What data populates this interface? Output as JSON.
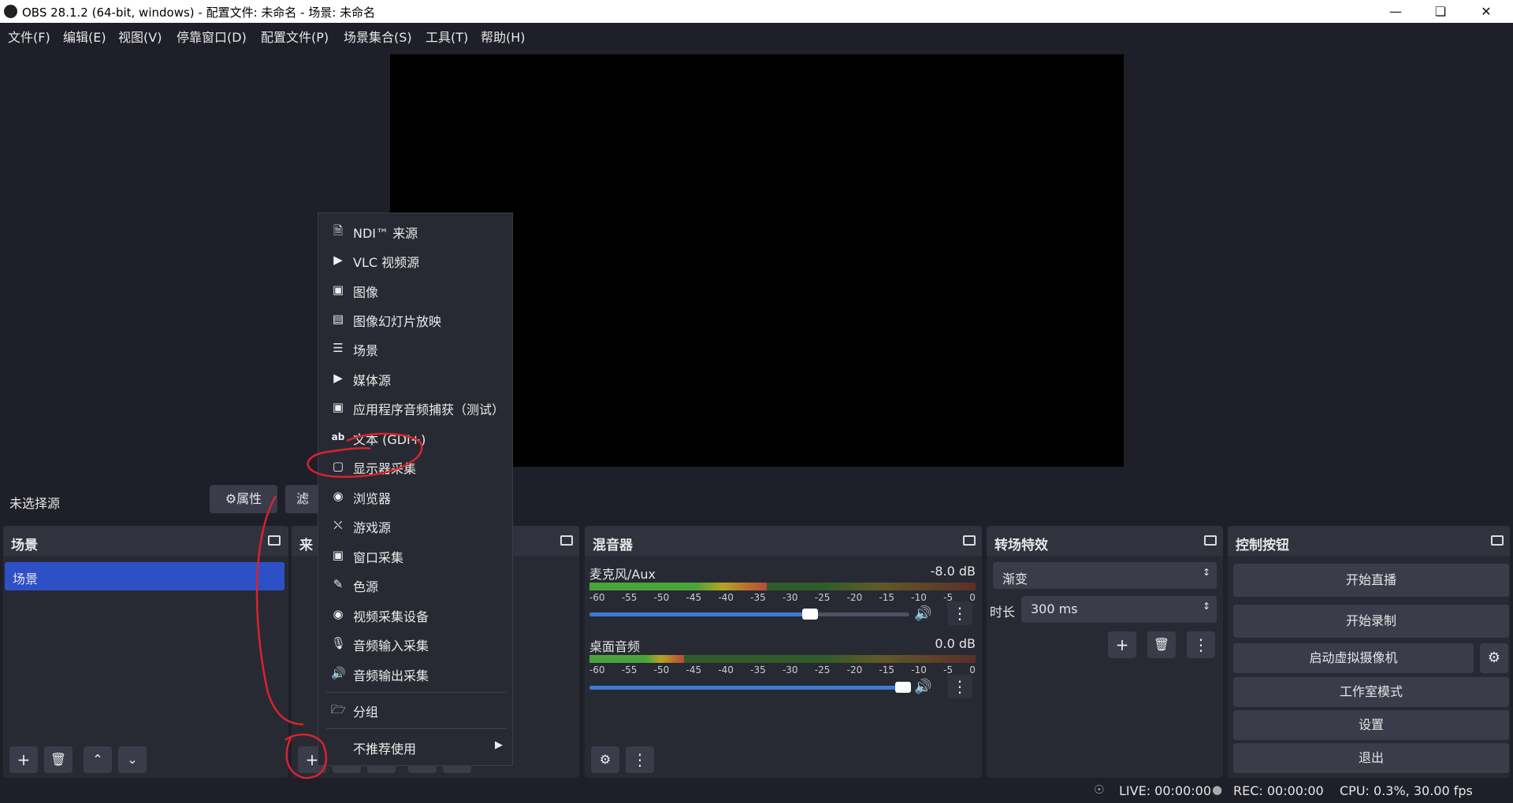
{
  "window": {
    "title": "OBS 28.1.2 (64-bit, windows) - 配置文件: 未命名 - 场景: 未命名",
    "minimize_icon": "minimize-icon",
    "maximize_icon": "restore-icon",
    "close_icon": "close-icon"
  },
  "menu": [
    "文件(F)",
    "编辑(E)",
    "视图(V)",
    "停靠窗口(D)",
    "配置文件(P)",
    "场景集合(S)",
    "工具(T)",
    "帮助(H)"
  ],
  "source_bar": {
    "no_source": "未选择源",
    "properties": "属性",
    "filters_partial": "滤"
  },
  "scenes": {
    "title": "场景",
    "items": [
      "场景"
    ],
    "selected_color": "#2e50c7"
  },
  "sources": {
    "title_partial": "来"
  },
  "mixer": {
    "title": "混音器",
    "channels": [
      {
        "name": "麦克风/Aux",
        "db": "-8.0 dB",
        "volume_fraction": 0.69
      },
      {
        "name": "桌面音频",
        "db": "0.0 dB",
        "volume_fraction": 0.98
      }
    ],
    "ticks": [
      "-60",
      "-55",
      "-50",
      "-45",
      "-40",
      "-35",
      "-30",
      "-25",
      "-20",
      "-15",
      "-10",
      "-5",
      "0"
    ]
  },
  "transitions": {
    "title": "转场特效",
    "selected": "渐变",
    "duration_label": "时长",
    "duration_value": "300 ms"
  },
  "controls": {
    "title": "控制按钮",
    "start_stream": "开始直播",
    "start_record": "开始录制",
    "virtual_cam": "启动虚拟摄像机",
    "studio_mode": "工作室模式",
    "settings": "设置",
    "exit": "退出"
  },
  "context_menu": {
    "items": [
      {
        "label": "NDI™ 来源",
        "icon": "file-icon"
      },
      {
        "label": "VLC 视频源",
        "icon": "play-icon"
      },
      {
        "label": "图像",
        "icon": "image-icon"
      },
      {
        "label": "图像幻灯片放映",
        "icon": "slideshow-icon"
      },
      {
        "label": "场景",
        "icon": "list-icon"
      },
      {
        "label": "媒体源",
        "icon": "play-icon"
      },
      {
        "label": "应用程序音频捕获（测试）",
        "icon": "app-audio-icon"
      },
      {
        "label": "文本 (GDI+)",
        "icon": "text-icon"
      },
      {
        "label": "显示器采集",
        "icon": "monitor-icon"
      },
      {
        "label": "浏览器",
        "icon": "globe-icon"
      },
      {
        "label": "游戏源",
        "icon": "gamepad-icon"
      },
      {
        "label": "窗口采集",
        "icon": "window-icon"
      },
      {
        "label": "色源",
        "icon": "brush-icon"
      },
      {
        "label": "视频采集设备",
        "icon": "camera-icon"
      },
      {
        "label": "音频输入采集",
        "icon": "microphone-icon"
      },
      {
        "label": "音频输出采集",
        "icon": "speaker-icon"
      }
    ],
    "group": "分组",
    "deprecated": "不推荐使用"
  },
  "status": {
    "live": "LIVE: 00:00:00",
    "rec": "REC: 00:00:00",
    "cpu": "CPU: 0.3%, 30.00 fps"
  },
  "annotation_color": "#d9232d"
}
